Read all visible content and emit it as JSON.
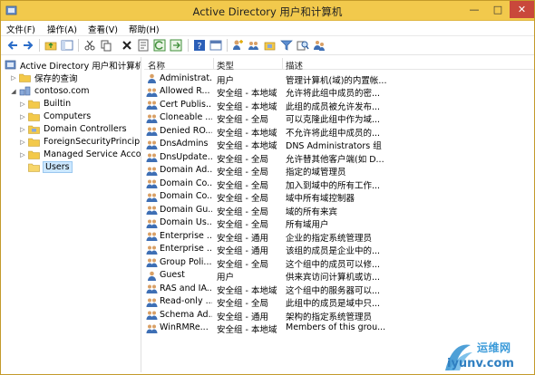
{
  "window": {
    "title": "Active Directory 用户和计算机"
  },
  "menu": [
    "文件(F)",
    "操作(A)",
    "查看(V)",
    "帮助(H)"
  ],
  "toolbar_icons": [
    "back-icon",
    "forward-icon",
    "up-folder-icon",
    "console-tree-icon",
    "cut-icon",
    "copy-icon",
    "delete-icon",
    "properties-icon",
    "refresh-icon",
    "export-icon",
    "help-icon",
    "console-icon",
    "add-user-icon",
    "add-group-icon",
    "add-ou-icon",
    "filter-icon",
    "find-icon",
    "group-icon"
  ],
  "tree": {
    "root": "Active Directory 用户和计算机",
    "saved_queries": "保存的查询",
    "domain": "contoso.com",
    "children": [
      "Builtin",
      "Computers",
      "Domain Controllers",
      "ForeignSecurityPrincip...",
      "Managed Service Acco",
      "Users"
    ]
  },
  "columns": {
    "name": "名称",
    "type": "类型",
    "desc": "描述"
  },
  "rows": [
    {
      "name": "Administrat...",
      "type": "用户",
      "desc": "管理计算机(域)的内置帐...",
      "icon": "user-icon"
    },
    {
      "name": "Allowed R...",
      "type": "安全组 - 本地域",
      "desc": "允许将此组中成员的密...",
      "icon": "group-icon"
    },
    {
      "name": "Cert Publis...",
      "type": "安全组 - 本地域",
      "desc": "此组的成员被允许发布...",
      "icon": "group-icon"
    },
    {
      "name": "Cloneable ...",
      "type": "安全组 - 全局",
      "desc": "可以克隆此组中作为域...",
      "icon": "group-icon"
    },
    {
      "name": "Denied RO...",
      "type": "安全组 - 本地域",
      "desc": "不允许将此组中成员的...",
      "icon": "group-icon"
    },
    {
      "name": "DnsAdmins",
      "type": "安全组 - 本地域",
      "desc": "DNS Administrators 组",
      "icon": "group-icon"
    },
    {
      "name": "DnsUpdate...",
      "type": "安全组 - 全局",
      "desc": "允许替其他客户端(如 D...",
      "icon": "group-icon"
    },
    {
      "name": "Domain Ad...",
      "type": "安全组 - 全局",
      "desc": "指定的域管理员",
      "icon": "group-icon"
    },
    {
      "name": "Domain Co...",
      "type": "安全组 - 全局",
      "desc": "加入到域中的所有工作...",
      "icon": "group-icon"
    },
    {
      "name": "Domain Co...",
      "type": "安全组 - 全局",
      "desc": "域中所有域控制器",
      "icon": "group-icon"
    },
    {
      "name": "Domain Gu...",
      "type": "安全组 - 全局",
      "desc": "域的所有来宾",
      "icon": "group-icon"
    },
    {
      "name": "Domain Us...",
      "type": "安全组 - 全局",
      "desc": "所有域用户",
      "icon": "group-icon"
    },
    {
      "name": "Enterprise ...",
      "type": "安全组 - 通用",
      "desc": "企业的指定系统管理员",
      "icon": "group-icon"
    },
    {
      "name": "Enterprise ...",
      "type": "安全组 - 通用",
      "desc": "该组的成员是企业中的...",
      "icon": "group-icon"
    },
    {
      "name": "Group Poli...",
      "type": "安全组 - 全局",
      "desc": "这个组中的成员可以修...",
      "icon": "group-icon"
    },
    {
      "name": "Guest",
      "type": "用户",
      "desc": "供来宾访问计算机或访...",
      "icon": "user-icon"
    },
    {
      "name": "RAS and IA...",
      "type": "安全组 - 本地域",
      "desc": "这个组中的服务器可以...",
      "icon": "group-icon"
    },
    {
      "name": "Read-only ...",
      "type": "安全组 - 全局",
      "desc": "此组中的成员是域中只...",
      "icon": "group-icon"
    },
    {
      "name": "Schema Ad...",
      "type": "安全组 - 通用",
      "desc": "架构的指定系统管理员",
      "icon": "group-icon"
    },
    {
      "name": "WinRMRe...",
      "type": "安全组 - 本地域",
      "desc": "Members of this grou...",
      "icon": "group-icon"
    }
  ],
  "watermark": {
    "text": "运维网",
    "url": "iyunv.com"
  }
}
